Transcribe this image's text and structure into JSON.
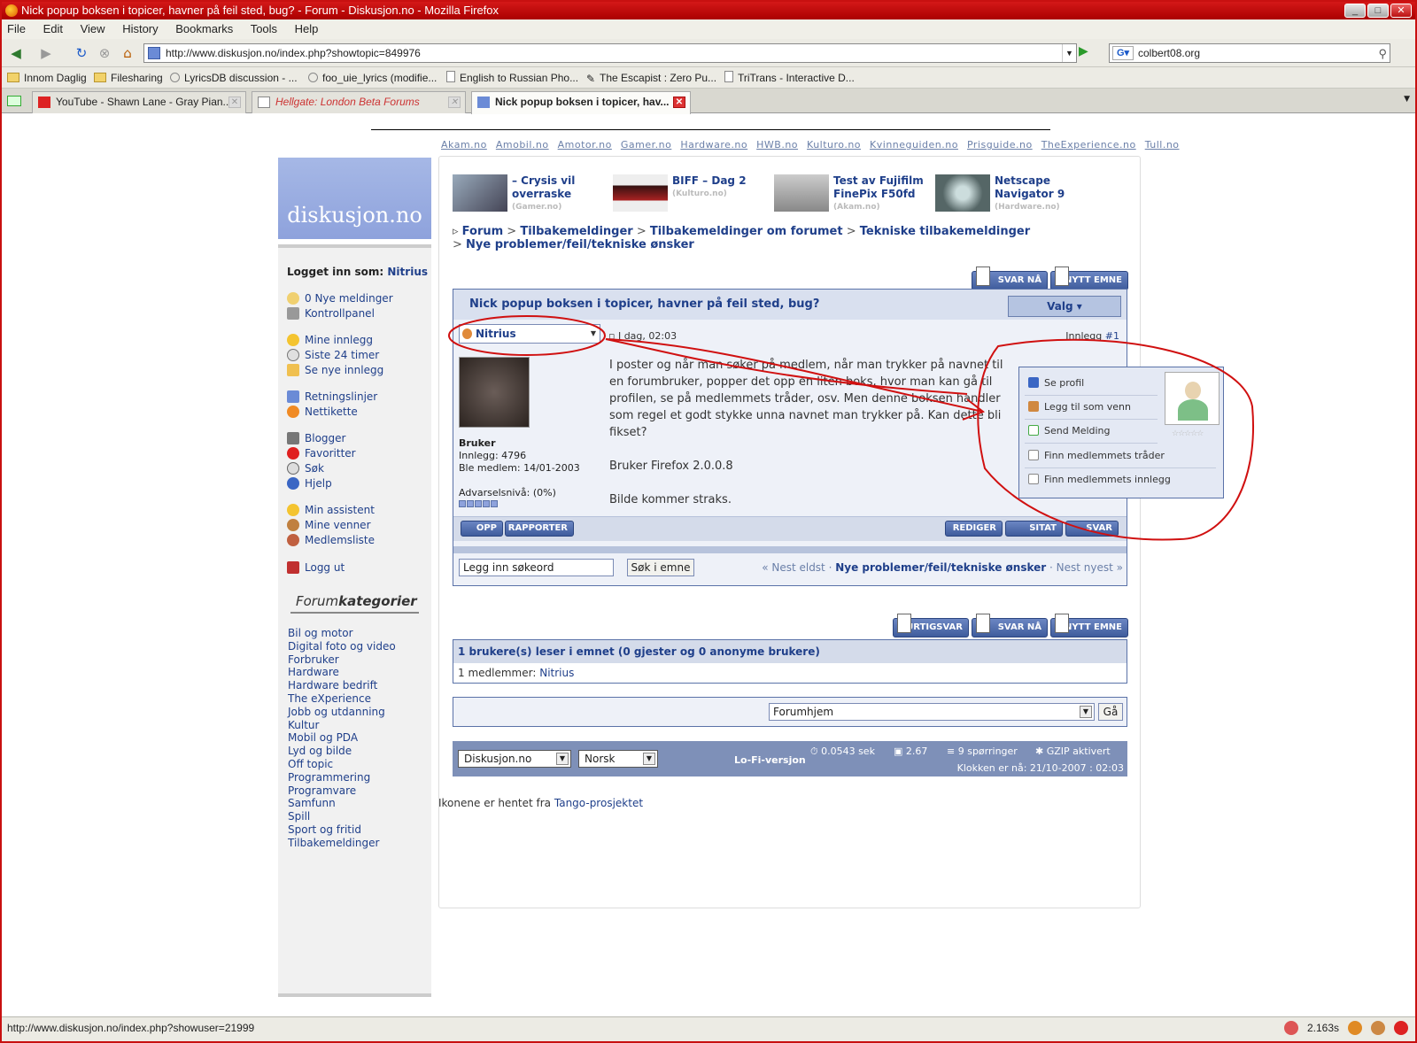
{
  "browser": {
    "title": "Nick popup boksen i topicer, havner på feil sted, bug? - Forum - Diskusjon.no - Mozilla Firefox",
    "menu": [
      "File",
      "Edit",
      "View",
      "History",
      "Bookmarks",
      "Tools",
      "Help"
    ],
    "url": "http://www.diskusjon.no/index.php?showtopic=849976",
    "search_value": "colbert08.org",
    "bookmarks": [
      "Innom Daglig",
      "Filesharing",
      "LyricsDB discussion - ...",
      "foo_uie_lyrics (modifie...",
      "English to Russian Pho...",
      "The Escapist : Zero Pu...",
      "TriTrans - Interactive D..."
    ],
    "tabs": [
      "YouTube - Shawn Lane - Gray Pian...",
      "Hellgate: London Beta Forums",
      "Nick popup boksen i topicer, hav..."
    ],
    "status_url": "http://www.diskusjon.no/index.php?showuser=21999",
    "status_time": "2.163s"
  },
  "site": {
    "network_links": [
      "Akam.no",
      "Amobil.no",
      "Amotor.no",
      "Gamer.no",
      "Hardware.no",
      "HWB.no",
      "Kulturo.no",
      "Kvinneguiden.no",
      "Prisguide.no",
      "TheExperience.no",
      "Tull.no"
    ],
    "logo": "diskusjon.no",
    "news": [
      {
        "title1": "– Crysis vil",
        "title2": "overraske",
        "source": "(Gamer.no)"
      },
      {
        "title1": "BIFF – Dag 2",
        "title2": "",
        "source": "(Kulturo.no)"
      },
      {
        "title1": "Test av Fujifilm",
        "title2": "FinePix F50fd",
        "source": "(Akam.no)"
      },
      {
        "title1": "Netscape",
        "title2": "Navigator 9",
        "source": "(Hardware.no)"
      }
    ],
    "breadcrumb": {
      "c1": "Forum",
      "c2": "Tilbakemeldinger",
      "c3": "Tilbakemeldinger om forumet",
      "c4": "Tekniske tilbakemeldinger",
      "c5": "Nye problemer/feil/tekniske ønsker"
    }
  },
  "sidebar": {
    "login_label": "Logget inn som:",
    "login_user": "Nitrius",
    "items": [
      "0 Nye meldinger",
      "Kontrollpanel",
      "Mine innlegg",
      "Siste 24 timer",
      "Se nye innlegg",
      "Retningslinjer",
      "Nettikette",
      "Blogger",
      "Favoritter",
      "Søk",
      "Hjelp",
      "Min assistent",
      "Mine venner",
      "Medlemsliste",
      "Logg ut"
    ],
    "forum_cat_a": "Forum",
    "forum_cat_b": "kategorier",
    "categories": [
      "Bil og motor",
      "Digital foto og video",
      "Forbruker",
      "Hardware",
      "Hardware bedrift",
      "The eXperience",
      "Jobb og utdanning",
      "Kultur",
      "Mobil og PDA",
      "Lyd og bilde",
      "Off topic",
      "Programmering",
      "Programvare",
      "Samfunn",
      "Spill",
      "Sport og fritid",
      "Tilbakemeldinger"
    ]
  },
  "buttons": {
    "svar_na": "SVAR NÅ",
    "nytt_emne": "NYTT EMNE",
    "hurtigsvar": "HURTIGSVAR",
    "opp": "OPP",
    "rapporter": "RAPPORTER",
    "rediger": "REDIGER",
    "sitat": "SITAT",
    "svar": "SVAR",
    "valg": "Valg ▾",
    "sok_emne": "Søk i emne",
    "ga": "Gå"
  },
  "post": {
    "topic_title": "Nick popup boksen i topicer, havner på feil sted, bug?",
    "author": "Nitrius",
    "date": "I dag, 02:03",
    "number_label": "Innlegg",
    "number": "#1",
    "rank": "Bruker",
    "posts": "Innlegg: 4796",
    "member_since": "Ble medlem: 14/01-2003",
    "warn": "Advarselsnivå: (0%)",
    "text1": "I poster og når man søker på medlem, når man trykker på navnet til en forumbruker, popper det opp en liten boks, hvor man kan gå til profilen, se på medlemmets tråder, osv. Men denne boksen handler som regel et godt stykke unna navnet man trykker på. Kan dette bli fikset?",
    "text2": "Bruker Firefox 2.0.0.8",
    "text3": "Bilde kommer straks."
  },
  "popup": {
    "items": [
      "Se profil",
      "Legg til som venn",
      "Send Melding",
      "Finn medlemmets tråder",
      "Finn medlemmets innlegg"
    ],
    "stars": "☆☆☆☆☆"
  },
  "topicsearch": {
    "placeholder": "Legg inn søkeord",
    "nav_prev": "« Nest eldst ·",
    "nav_forum": "Nye problemer/feil/tekniske ønsker",
    "nav_next": "· Nest nyest »"
  },
  "readers": {
    "header": "1 brukere(s) leser i emnet (0 gjester og 0 anonyme brukere)",
    "members_label": "1 medlemmer:",
    "member": "Nitrius"
  },
  "jump": {
    "selected": "Forumhjem"
  },
  "footer": {
    "site_sel": "Diskusjon.no",
    "lang_sel": "Norsk",
    "lofi": "Lo-Fi-versjon",
    "time": "0.0543 sek",
    "load": "2.67",
    "queries": "9 spørringer",
    "gzip": "GZIP aktivert",
    "clock": "Klokken er nå: 21/10-2007 : 02:03"
  },
  "credit": {
    "prefix": "Ikonene er hentet fra",
    "link": "Tango-prosjektet"
  }
}
